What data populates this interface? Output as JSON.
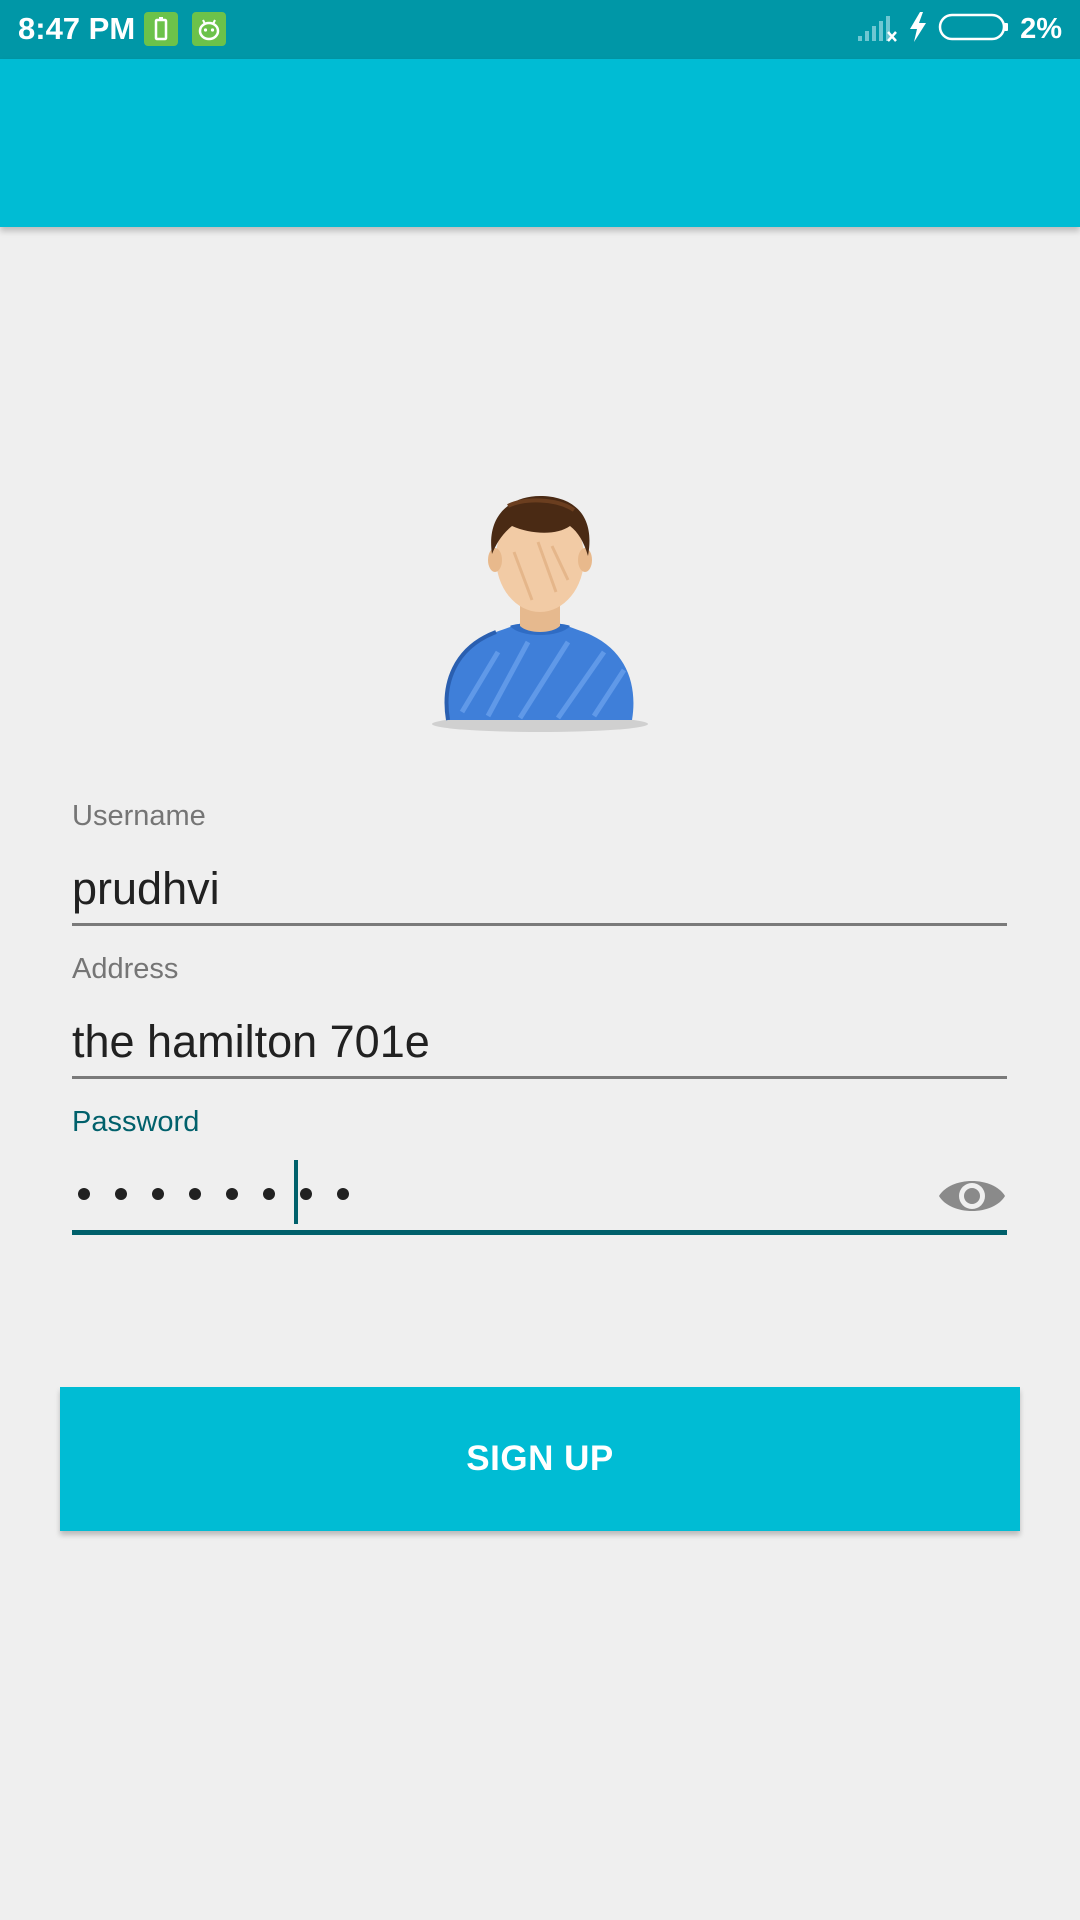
{
  "status_bar": {
    "time": "8:47 PM",
    "battery_percent": "2%",
    "icons": [
      "battery-notification-icon",
      "android-notification-icon",
      "signal-off-icon",
      "charging-bolt-icon",
      "battery-icon"
    ]
  },
  "app_bar": {
    "title": "",
    "color": "#00bcd4"
  },
  "avatar": {
    "icon": "user-avatar-icon"
  },
  "form": {
    "username": {
      "label": "Username",
      "value": "prudhvi"
    },
    "address": {
      "label": "Address",
      "value": "the hamilton 701e"
    },
    "password": {
      "label": "Password",
      "masked_length": 8,
      "toggle_icon": "eye-icon"
    }
  },
  "signup_button": {
    "label": "SIGN UP"
  },
  "colors": {
    "status_bar": "#0097a7",
    "accent": "#00bcd4",
    "focused_field": "#00606b",
    "background": "#efefef"
  }
}
